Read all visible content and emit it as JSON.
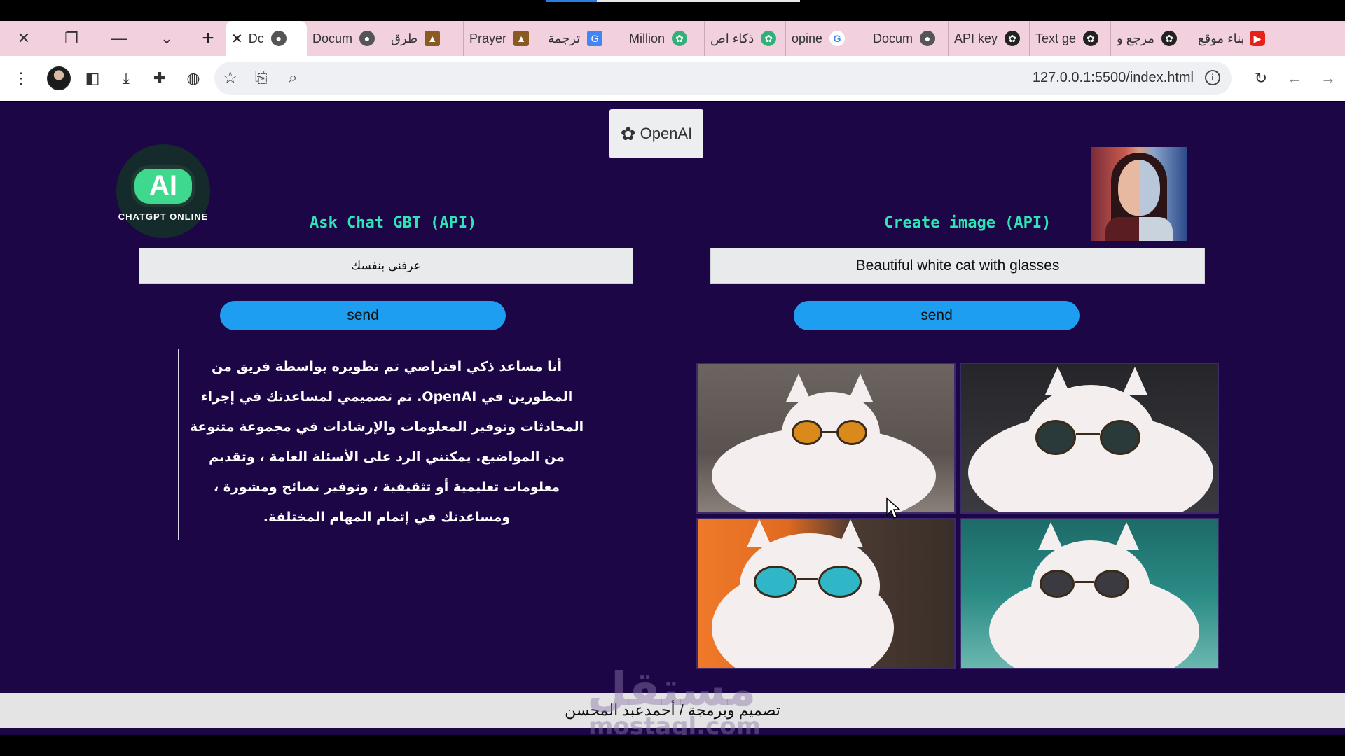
{
  "browser": {
    "tabs": [
      {
        "label": "بناء موقع",
        "icon": "youtube-icon",
        "icon_color": "#e62117"
      },
      {
        "label": "مرجع و",
        "icon": "openai-icon",
        "icon_color": "#222222"
      },
      {
        "label": "Text ge",
        "icon": "openai-icon",
        "icon_color": "#222222"
      },
      {
        "label": "API key",
        "icon": "openai-icon",
        "icon_color": "#222222"
      },
      {
        "label": "Docum",
        "icon": "globe-icon",
        "icon_color": "#555555"
      },
      {
        "label": "opine",
        "icon": "google-icon",
        "icon_color": "#4285f4"
      },
      {
        "label": "ذكاء اص",
        "icon": "chatgpt-green-icon",
        "icon_color": "#33b07a"
      },
      {
        "label": "Million",
        "icon": "chatgpt-green-icon",
        "icon_color": "#33b07a"
      },
      {
        "label": "ترجمة",
        "icon": "translate-icon",
        "icon_color": "#4285f4"
      },
      {
        "label": "Prayer",
        "icon": "mosque-icon",
        "icon_color": "#8a5a22"
      },
      {
        "label": "طرق",
        "icon": "mosque-icon",
        "icon_color": "#8a5a22"
      },
      {
        "label": "Docum",
        "icon": "globe-icon",
        "icon_color": "#555555"
      },
      {
        "label": "Dc",
        "icon": "globe-icon",
        "icon_color": "#555555",
        "active": true
      }
    ],
    "url": "127.0.0.1:5500/index.html"
  },
  "page": {
    "badge": "OpenAI",
    "ai_logo_text": "AI",
    "ai_logo_caption": "CHATGPT ONLINE",
    "chat": {
      "title": "Ask Chat GBT (API)",
      "input_value": "عرفنى بنفسك",
      "send_label": "send",
      "answer": "أنا مساعد ذكي افتراضي تم تطويره بواسطة فريق من المطورين في OpenAI. تم تصميمي لمساعدتك في إجراء المحادثات وتوفير المعلومات والإرشادات في مجموعة متنوعة من المواضيع. يمكنني الرد على الأسئلة العامة ، وتقديم معلومات تعليمية أو تثقيفية ، وتوفير نصائح ومشورة ، ومساعدتك في إتمام المهام المختلفة."
    },
    "image": {
      "title": "Create image (API)",
      "input_value": "Beautiful white cat with glasses",
      "send_label": "send",
      "results": [
        "cat-with-orange-sunglasses",
        "cat-with-dark-round-glasses",
        "cat-with-blue-sunglasses",
        "cat-with-black-round-glasses"
      ]
    },
    "watermark": "مستقل",
    "watermark_sub": "mostaql.com",
    "footer": "تصميم وبرمجة / أحمدعبد المحسن"
  },
  "colors": {
    "page_bg": "#1c0646",
    "title_accent": "#2ee5b5",
    "button": "#1e9ef0",
    "tabbar": "#f2d0de"
  }
}
